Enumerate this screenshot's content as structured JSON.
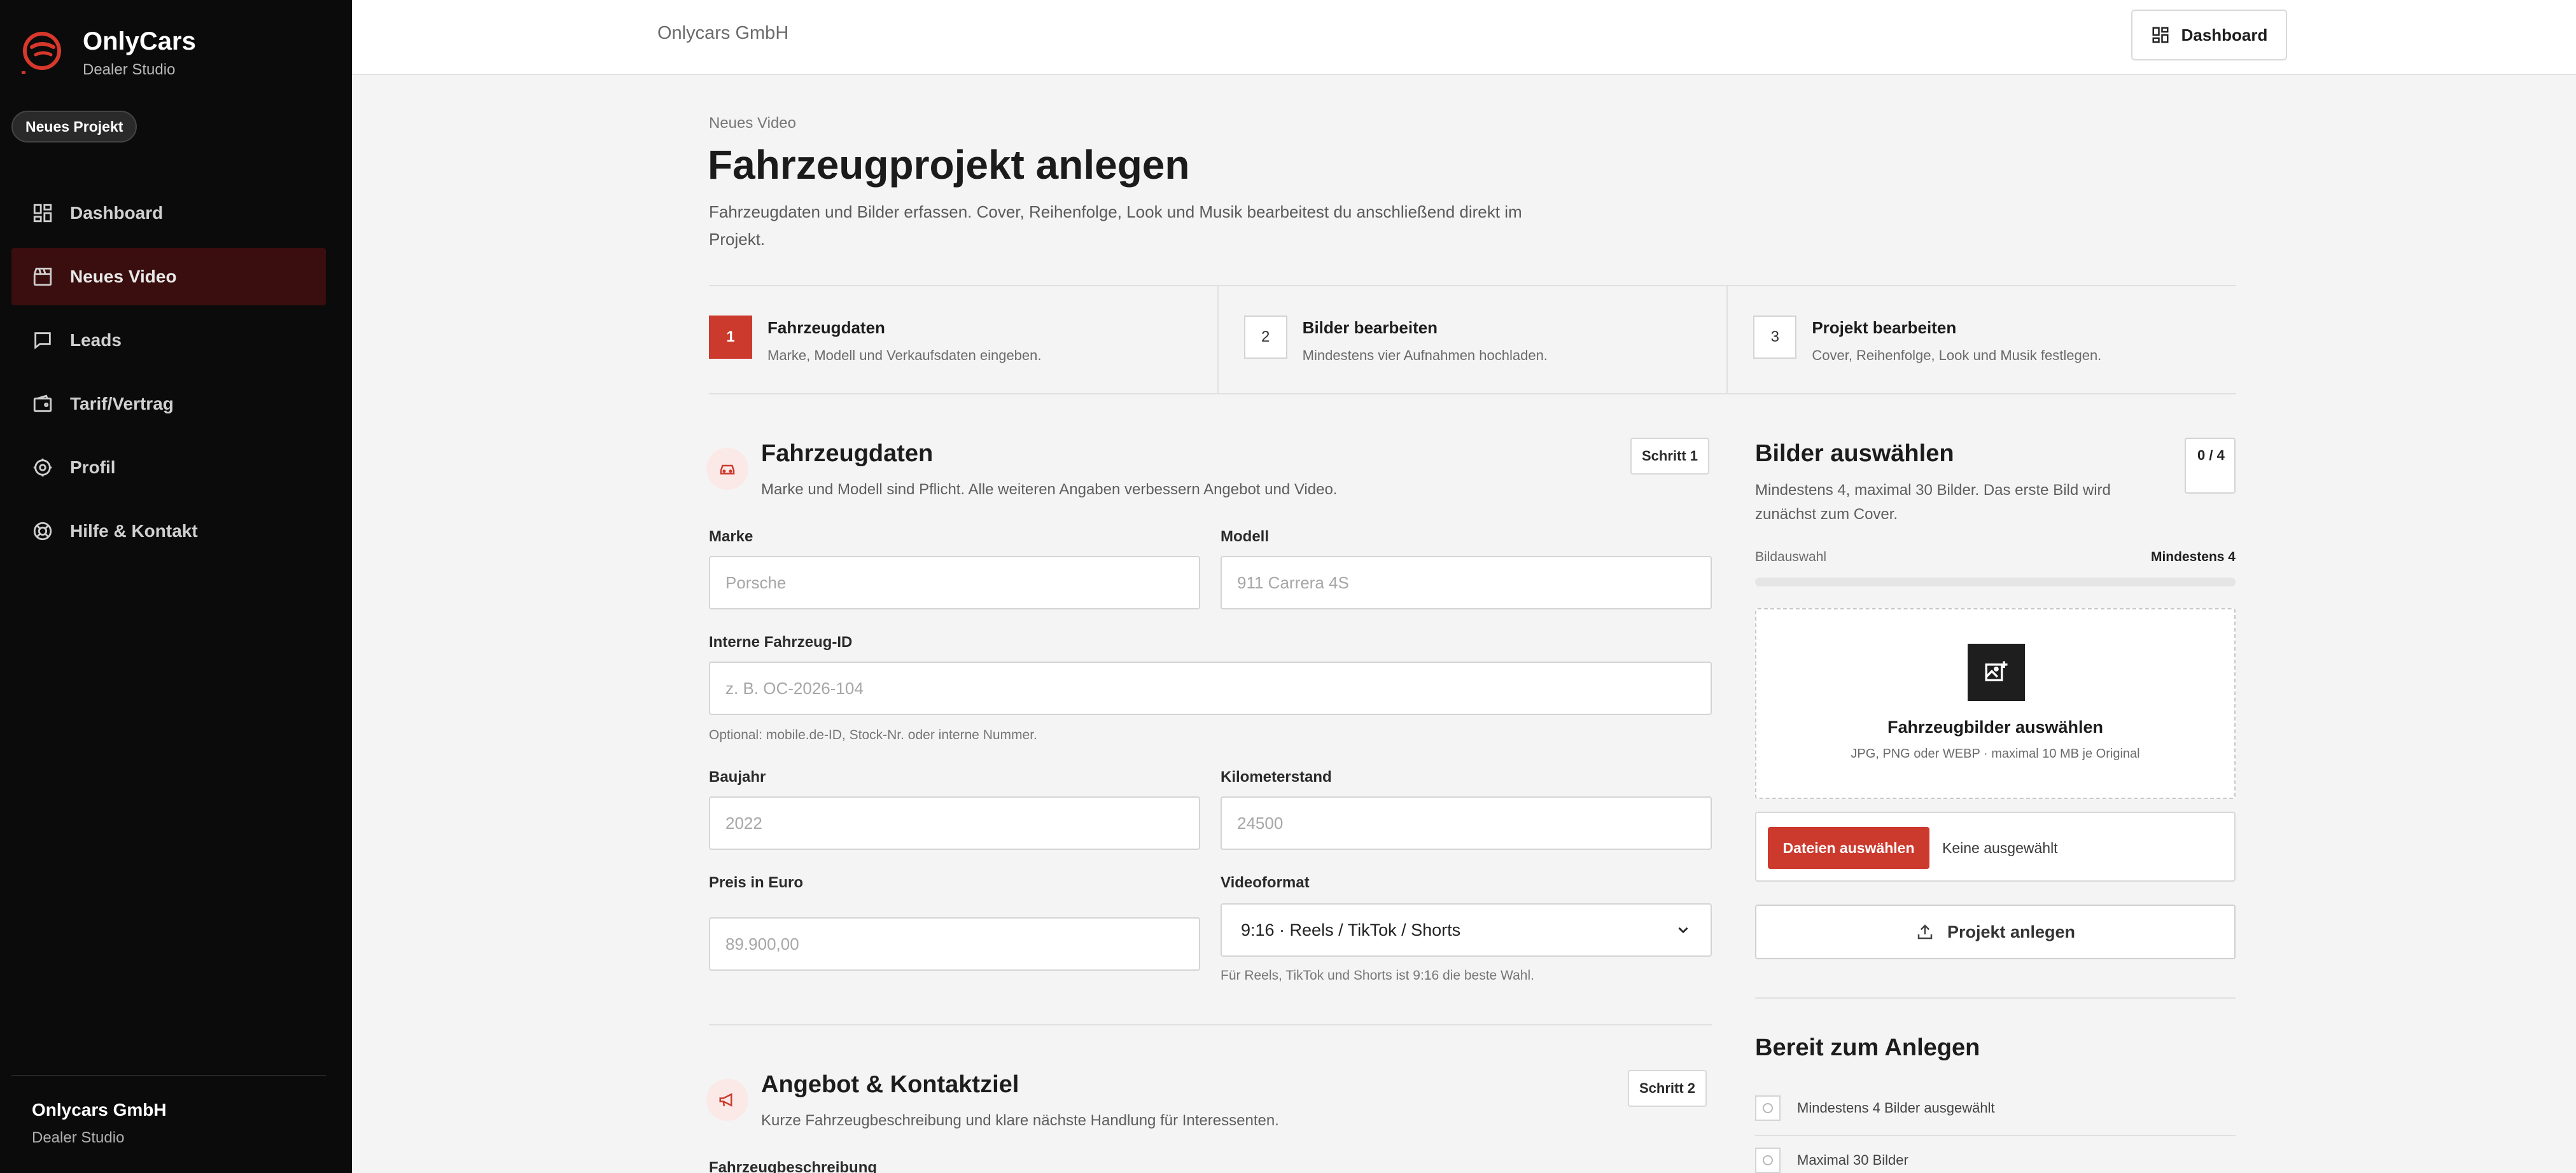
{
  "brand": {
    "name": "OnlyCars",
    "subtitle": "Dealer Studio"
  },
  "sidebar": {
    "new_project_pill": "Neues Projekt",
    "items": [
      {
        "label": "Dashboard",
        "icon": "dashboard-icon"
      },
      {
        "label": "Neues Video",
        "icon": "clapperboard-icon",
        "active": true
      },
      {
        "label": "Leads",
        "icon": "chat-icon"
      },
      {
        "label": "Tarif/Vertrag",
        "icon": "wallet-icon"
      },
      {
        "label": "Profil",
        "icon": "gear-icon"
      },
      {
        "label": "Hilfe & Kontakt",
        "icon": "lifebuoy-icon"
      }
    ],
    "footer": {
      "company": "Onlycars GmbH",
      "subtitle": "Dealer Studio"
    }
  },
  "topbar": {
    "company": "Onlycars GmbH",
    "dashboard_button": "Dashboard"
  },
  "page": {
    "eyebrow": "Neues Video",
    "title": "Fahrzeugprojekt anlegen",
    "description": "Fahrzeugdaten und Bilder erfassen. Cover, Reihenfolge, Look und Musik bearbeitest du anschließend direkt im Projekt."
  },
  "steps": [
    {
      "num": "1",
      "title": "Fahrzeugdaten",
      "subtitle": "Marke, Modell und Verkaufsdaten eingeben.",
      "active": true
    },
    {
      "num": "2",
      "title": "Bilder bearbeiten",
      "subtitle": "Mindestens vier Aufnahmen hochladen."
    },
    {
      "num": "3",
      "title": "Projekt bearbeiten",
      "subtitle": "Cover, Reihenfolge, Look und Musik festlegen."
    }
  ],
  "vehicle_section": {
    "title": "Fahrzeugdaten",
    "subtitle": "Marke und Modell sind Pflicht. Alle weiteren Angaben verbessern Angebot und Video.",
    "step_pill": "Schritt 1",
    "fields": {
      "brand": {
        "label": "Marke",
        "placeholder": "Porsche",
        "value": ""
      },
      "model": {
        "label": "Modell",
        "placeholder": "911 Carrera 4S",
        "value": ""
      },
      "internal_id": {
        "label": "Interne Fahrzeug-ID",
        "placeholder": "z. B. OC-2026-104",
        "value": "",
        "hint": "Optional: mobile.de-ID, Stock-Nr. oder interne Nummer."
      },
      "year": {
        "label": "Baujahr",
        "placeholder": "2022",
        "value": ""
      },
      "mileage": {
        "label": "Kilometerstand",
        "placeholder": "24500",
        "value": ""
      },
      "price": {
        "label": "Preis in Euro",
        "placeholder": "89.900,00",
        "value": ""
      },
      "video_format": {
        "label": "Videoformat",
        "selected": "9:16 · Reels / TikTok / Shorts",
        "hint": "Für Reels, TikTok und Shorts ist 9:16 die beste Wahl."
      }
    }
  },
  "offer_section": {
    "title": "Angebot & Kontaktziel",
    "subtitle": "Kurze Fahrzeugbeschreibung und klare nächste Handlung für Interessenten.",
    "step_pill": "Schritt 2",
    "first_field_label": "Fahrzeugbeschreibung"
  },
  "images_panel": {
    "title": "Bilder auswählen",
    "count": "0 / 4",
    "subtitle": "Mindestens 4, maximal 30 Bilder. Das erste Bild wird zunächst zum Cover.",
    "progress_label": "Bildauswahl",
    "progress_requirement": "Mindestens 4",
    "progress_fraction": 0,
    "dropzone_title": "Fahrzeugbilder auswählen",
    "dropzone_sub": "JPG, PNG oder WEBP · maximal 10 MB je Original",
    "file_button": "Dateien auswählen",
    "file_status": "Keine ausgewählt",
    "create_button": "Projekt anlegen"
  },
  "ready": {
    "title": "Bereit zum Anlegen",
    "checks": [
      "Mindestens 4 Bilder ausgewählt",
      "Maximal 30 Bilder"
    ]
  },
  "colors": {
    "accent": "#cc3a2d",
    "sidebar_bg": "#0b0b0b",
    "active_nav_bg": "#3a0e0e"
  }
}
